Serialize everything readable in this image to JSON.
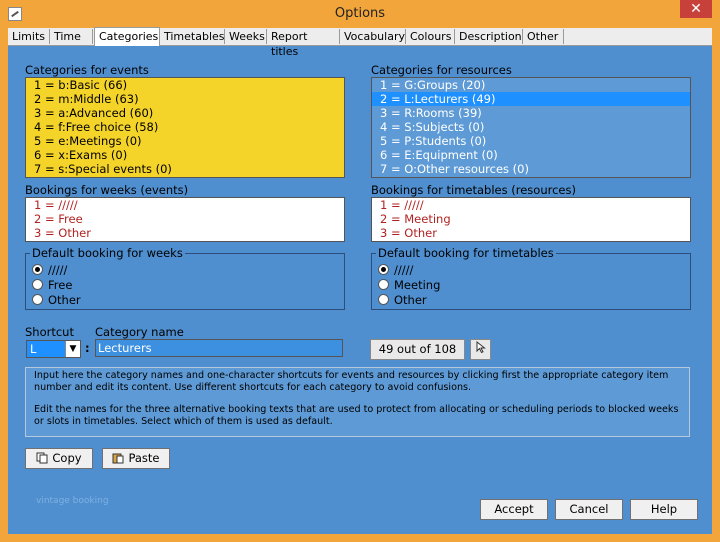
{
  "window": {
    "title": "Options",
    "close_glyph": "✕"
  },
  "tabs": [
    "Limits",
    "Time",
    "Categories",
    "Timetables",
    "Weeks",
    "Report titles",
    "Vocabulary",
    "Colours",
    "Description",
    "Other"
  ],
  "active_tab": "Categories",
  "events": {
    "label": "Categories for events",
    "items": [
      "1 = b:Basic  (66)",
      "2 = m:Middle  (63)",
      "3 = a:Advanced  (60)",
      "4 = f:Free choice  (58)",
      "5 = e:Meetings  (0)",
      "6 = x:Exams  (0)",
      "7 = s:Special events  (0)"
    ]
  },
  "resources": {
    "label": "Categories for resources",
    "items": [
      "1 = G:Groups  (20)",
      "2 = L:Lecturers  (49)",
      "3 = R:Rooms  (39)",
      "4 = S:Subjects  (0)",
      "5 = P:Students  (0)",
      "6 = E:Equipment  (0)",
      "7 = O:Other resources  (0)"
    ],
    "selected_index": 1
  },
  "bookings_weeks": {
    "label": "Bookings for weeks (events)",
    "items": [
      "1 = /////",
      "2 = Free",
      "3 = Other"
    ]
  },
  "bookings_timetables": {
    "label": "Bookings for timetables (resources)",
    "items": [
      "1 = /////",
      "2 = Meeting",
      "3 = Other"
    ]
  },
  "default_weeks": {
    "legend": "Default booking for weeks",
    "options": [
      "/////",
      "Free",
      "Other"
    ],
    "selected": 0
  },
  "default_timetables": {
    "legend": "Default booking for timetables",
    "options": [
      "/////",
      "Meeting",
      "Other"
    ],
    "selected": 0
  },
  "shortcut": {
    "label": "Shortcut",
    "value": "L",
    "separator": ":"
  },
  "category_name": {
    "label": "Category name",
    "value": "Lecturers"
  },
  "counter": "49 out of 108",
  "help": [
    "Input here the category names and one-character shortcuts for events and resources by clicking first the appropriate category item number and edit its content. Use different shortcuts for each category to avoid confusions.",
    "Edit the names for the three alternative booking texts that are used to protect from allocating or scheduling periods to blocked weeks or slots in timetables. Select which of them is used as default."
  ],
  "buttons": {
    "copy": "Copy",
    "paste": "Paste",
    "accept": "Accept",
    "cancel": "Cancel",
    "help": "Help"
  },
  "faint_text": "vintage booking",
  "colors": {
    "client_bg": "#4f8fcf",
    "events_bg": "#f5d42a",
    "selection": "#1e90ff",
    "frame": "#f2a53a"
  }
}
